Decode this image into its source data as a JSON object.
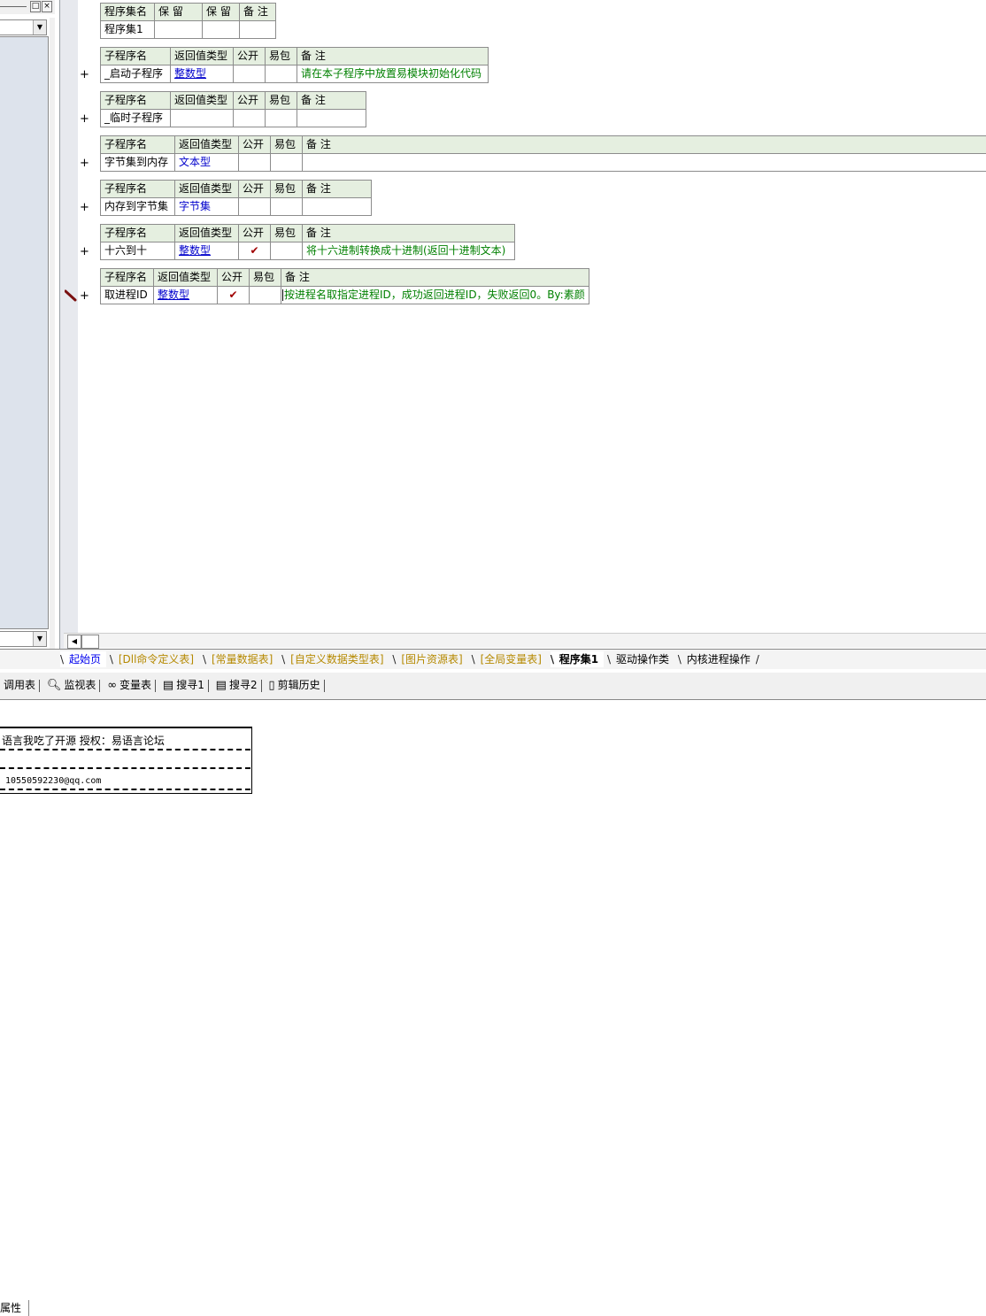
{
  "left_panel": {
    "restore_icon": "□",
    "close_icon": "×",
    "dropdown_icon": "▼",
    "tab_label": "属性"
  },
  "program_set": {
    "headers": [
      "程序集名",
      "保 留",
      "保 留",
      "备 注"
    ],
    "values": [
      "程序集1",
      "",
      "",
      ""
    ]
  },
  "sub_headers": [
    "子程序名",
    "返回值类型",
    "公开",
    "易包",
    "备 注"
  ],
  "subroutines": [
    {
      "name": "_启动子程序",
      "type": "整数型",
      "public": "",
      "ebao": "",
      "remark": "请在本子程序中放置易模块初始化代码",
      "expand": "+"
    },
    {
      "name": "_临时子程序",
      "type": "",
      "public": "",
      "ebao": "",
      "remark": "",
      "expand": "+"
    },
    {
      "name": "字节集到内存",
      "type": "文本型",
      "public": "",
      "ebao": "",
      "remark": "",
      "expand": "+"
    },
    {
      "name": "内存到字节集",
      "type": "字节集",
      "public": "",
      "ebao": "",
      "remark": "",
      "expand": "+"
    },
    {
      "name": "十六到十",
      "type": "整数型",
      "public": "✔",
      "ebao": "",
      "remark": "将十六进制转换成十进制(返回十进制文本)",
      "expand": "+"
    },
    {
      "name": "取进程ID",
      "type": "整数型",
      "public": "✔",
      "ebao": "",
      "remark": "按进程名取指定进程ID，成功返回进程ID，失败返回0。By:素颜",
      "expand": "+"
    }
  ],
  "code_tabs": [
    "起始页",
    "[Dll命令定义表]",
    "[常量数据表]",
    "[自定义数据类型表]",
    "[图片资源表]",
    "[全局变量表]",
    "程序集1",
    "驱动操作类",
    "内核进程操作"
  ],
  "tool_tabs": [
    {
      "label": "调用表",
      "icon": ""
    },
    {
      "label": "监视表",
      "icon": "magnifier-icon"
    },
    {
      "label": "变量表",
      "icon": "glasses-icon"
    },
    {
      "label": "搜寻1",
      "icon": "search-doc-icon"
    },
    {
      "label": "搜寻2",
      "icon": "search-doc-icon"
    },
    {
      "label": "剪辑历史",
      "icon": "clipboard-icon"
    }
  ],
  "output": {
    "line1": "语言我吃了开源     授权：易语言论坛",
    "line2": "10550592230@qq.com"
  }
}
